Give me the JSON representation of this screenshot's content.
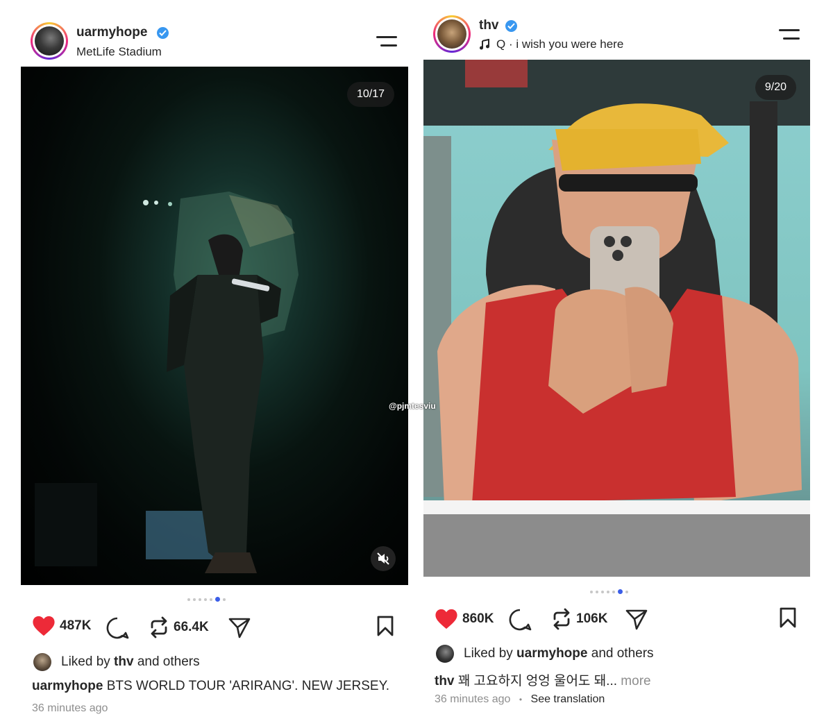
{
  "left_post": {
    "username": "uarmyhope",
    "location": "MetLife Stadium",
    "counter": "10/17",
    "likes": "487K",
    "reposts": "66.4K",
    "liked_by_prefix": "Liked by ",
    "liked_by_user": "thv",
    "liked_by_suffix": " and others",
    "caption_user": "uarmyhope",
    "caption_text": " BTS WORLD TOUR 'ARIRANG'. NEW JERSEY.",
    "time": "36 minutes ago",
    "carousel_total": 7,
    "carousel_active": 6
  },
  "right_post": {
    "username": "thv",
    "music": "Q · i wish you were here",
    "counter": "9/20",
    "likes": "860K",
    "reposts": "106K",
    "liked_by_prefix": "Liked by ",
    "liked_by_user": "uarmyhope",
    "liked_by_suffix": " and others",
    "caption_user": "thv",
    "caption_text": " 꽤 고요하지 엉엉 울어도 돼...",
    "more": " more",
    "time": "36 minutes ago",
    "separator": "•",
    "see_translation": "See translation",
    "carousel_total": 7,
    "carousel_active": 6
  },
  "watermark": "@pjmtesviu",
  "colors": {
    "heart": "#ed2a38",
    "verified": "#3897f0",
    "active_dot": "#3b5ee8",
    "muted_text": "#8e8e8e"
  },
  "icons": [
    "heart-icon",
    "comment-icon",
    "repost-icon",
    "share-icon",
    "bookmark-icon",
    "menu-icon",
    "verified-icon",
    "mute-icon",
    "music-note-icon"
  ]
}
